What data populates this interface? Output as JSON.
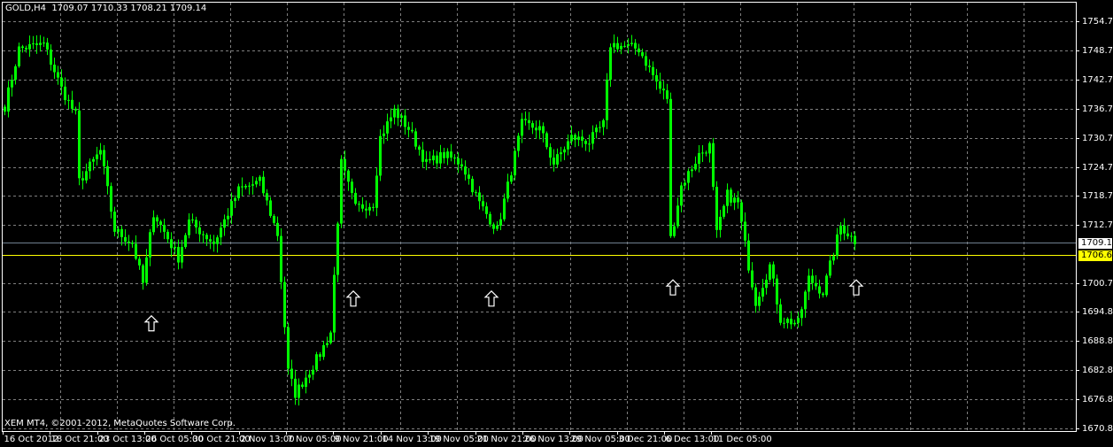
{
  "header": {
    "symbol": "GOLD,H4",
    "ohlc": "1709.07 1710.33 1708.21 1709.14"
  },
  "copyright": "XEM MT4, ©2001-2012, MetaQuotes Software Corp.",
  "colors": {
    "background": "#000000",
    "candles": "#00ff00",
    "grid": "#7f7f7f",
    "frame": "#ffffff",
    "bid_line": "#708090",
    "level_line": "#ffff00",
    "arrows": "#ffffff"
  },
  "chart_data": {
    "type": "candlestick",
    "title": "GOLD,H4",
    "ylim": [
      1670.85,
      1754.7
    ],
    "y_ticks": [
      "1754.70",
      "1748.70",
      "1742.70",
      "1736.70",
      "1730.70",
      "1724.70",
      "1718.70",
      "1712.70",
      "1700.70",
      "1694.85",
      "1688.85",
      "1682.85",
      "1676.85",
      "1670.85"
    ],
    "x_ticks": [
      "16 Oct 2012",
      "18 Oct 21:00",
      "23 Oct 13:00",
      "26 Oct 05:00",
      "30 Oct 21:00",
      "2 Nov 13:00",
      "7 Nov 05:00",
      "9 Nov 21:00",
      "14 Nov 13:00",
      "19 Nov 05:00",
      "21 Nov 21:00",
      "26 Nov 13:00",
      "29 Nov 05:00",
      "3 Dec 21:00",
      "6 Dec 13:00",
      "11 Dec 05:00"
    ],
    "bar_count": 241,
    "close_path": [
      [
        0,
        1737.2
      ],
      [
        4,
        1749
      ],
      [
        11,
        1750
      ],
      [
        16,
        1740.8
      ],
      [
        20,
        1735.4
      ],
      [
        21,
        1721.7
      ],
      [
        27,
        1728
      ],
      [
        31,
        1711.7
      ],
      [
        36,
        1709
      ],
      [
        39,
        1700.7
      ],
      [
        42,
        1715.3
      ],
      [
        49,
        1706
      ],
      [
        52,
        1713.5
      ],
      [
        59,
        1709
      ],
      [
        66,
        1719.9
      ],
      [
        72,
        1721.7
      ],
      [
        77,
        1710.8
      ],
      [
        80,
        1682.5
      ],
      [
        82,
        1678
      ],
      [
        89,
        1686.2
      ],
      [
        92,
        1690.7
      ],
      [
        95,
        1725.4
      ],
      [
        99,
        1716.2
      ],
      [
        104,
        1717.2
      ],
      [
        106,
        1730.8
      ],
      [
        110,
        1736.3
      ],
      [
        114,
        1732.6
      ],
      [
        119,
        1725.4
      ],
      [
        124,
        1727.2
      ],
      [
        129,
        1725.4
      ],
      [
        134,
        1717.2
      ],
      [
        139,
        1711.7
      ],
      [
        142,
        1720.8
      ],
      [
        146,
        1733.5
      ],
      [
        151,
        1732.6
      ],
      [
        155,
        1725.4
      ],
      [
        160,
        1730.8
      ],
      [
        165,
        1729.9
      ],
      [
        169,
        1733.5
      ],
      [
        171,
        1750
      ],
      [
        179,
        1749
      ],
      [
        185,
        1740.8
      ],
      [
        187,
        1739
      ],
      [
        188,
        1709.9
      ],
      [
        191,
        1720.8
      ],
      [
        196,
        1727.2
      ],
      [
        199,
        1729
      ],
      [
        201,
        1710.8
      ],
      [
        204,
        1719
      ],
      [
        207,
        1717.2
      ],
      [
        210,
        1704.4
      ],
      [
        212,
        1697
      ],
      [
        216,
        1704.4
      ],
      [
        219,
        1693.4
      ],
      [
        224,
        1692.5
      ],
      [
        227,
        1701.7
      ],
      [
        231,
        1698.9
      ],
      [
        236,
        1712.6
      ],
      [
        240,
        1709.5
      ]
    ],
    "horizontal_lines": [
      {
        "name": "bid",
        "price": "1709.14"
      },
      {
        "name": "level",
        "price": "1706.61"
      }
    ],
    "arrows": [
      {
        "bar": 41.5,
        "price": 1692.4
      },
      {
        "bar": 98.5,
        "price": 1697.5
      },
      {
        "bar": 137.5,
        "price": 1697.5
      },
      {
        "bar": 188.75,
        "price": 1699.8
      },
      {
        "bar": 240.5,
        "price": 1699.8
      }
    ]
  }
}
